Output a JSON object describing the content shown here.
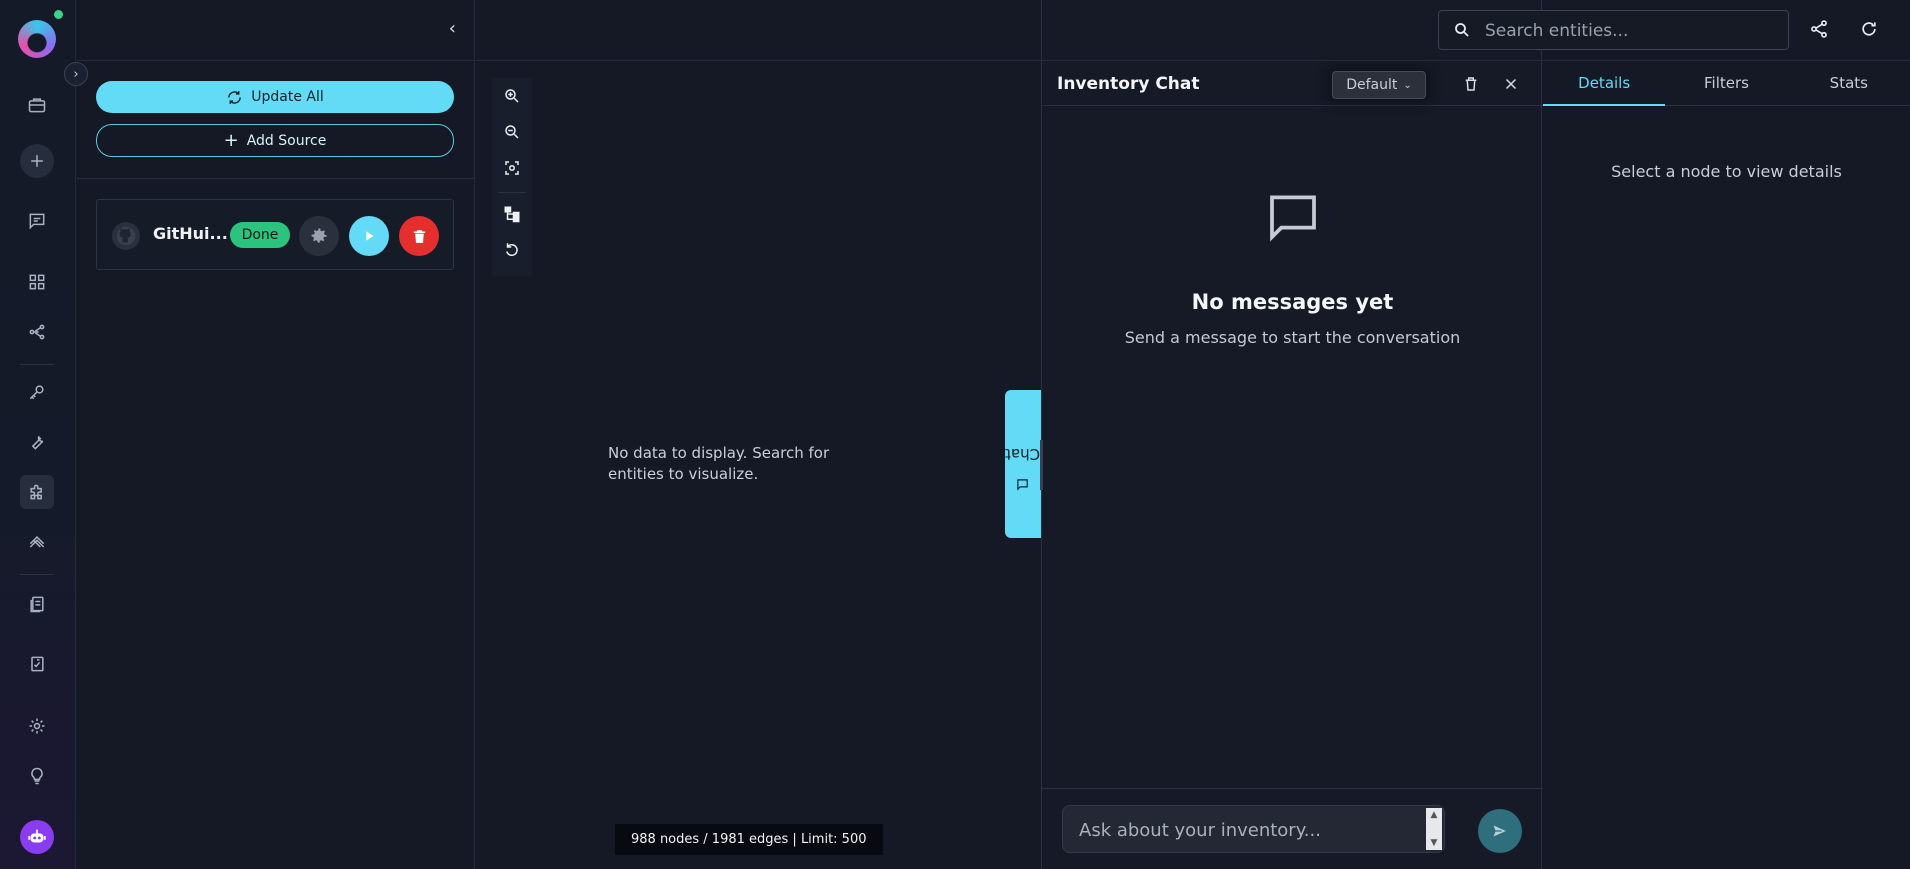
{
  "sidebar": {
    "icons": [
      "briefcase-icon",
      "plus-icon",
      "chat-icon",
      "grid-icon",
      "graph-icon",
      "key-icon",
      "wrench-icon",
      "puzzle-icon",
      "layers-icon",
      "documents-icon",
      "report-icon",
      "settings-icon",
      "lightbulb-icon",
      "bot-icon"
    ]
  },
  "sources": {
    "update_all_label": "Update All",
    "add_source_label": "Add Source",
    "items": [
      {
        "name": "GitHui...",
        "status": "Done"
      }
    ]
  },
  "graph": {
    "empty_message": "No data to display. Search for entities to visualize.",
    "stats": "988 nodes / 1981 edges | Limit: 500",
    "chat_tab_label": "Chat"
  },
  "chat": {
    "title": "Inventory Chat",
    "model": "Default",
    "empty_title": "No messages yet",
    "empty_subtitle": "Send a message to start the conversation",
    "input_placeholder": "Ask about your inventory..."
  },
  "details": {
    "tabs": [
      "Details",
      "Filters",
      "Stats"
    ],
    "active_tab": "Details",
    "hint": "Select a node to view details"
  },
  "header": {
    "search_placeholder": "Search entities..."
  },
  "colors": {
    "accent": "#63dbf6",
    "success": "#2bc47e",
    "danger": "#e52f2f",
    "background": "#141925"
  }
}
